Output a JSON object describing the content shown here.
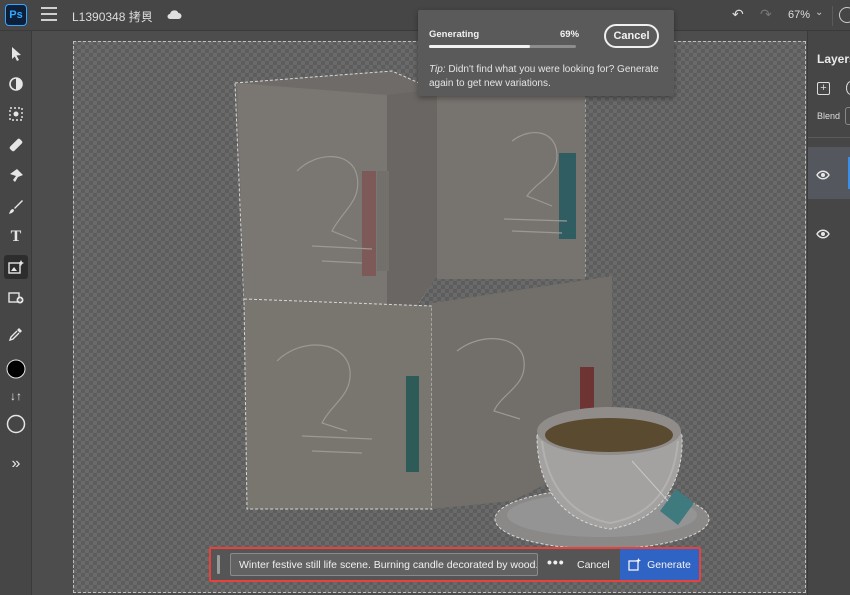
{
  "app": {
    "logo": "Ps",
    "document_title": "L1390348 拷貝",
    "zoom": "67%"
  },
  "toolbar": {
    "tools": [
      "move-tool-icon",
      "adjust-tool-icon",
      "select-subject-icon",
      "healing-brush-icon",
      "quick-action-icon",
      "brush-icon",
      "type-tool-icon",
      "generative-fill-icon",
      "add-image-icon",
      "eyedropper-icon",
      "foreground-color-swatch",
      "swap-colors-icon",
      "background-color-swatch",
      "more-tools-icon"
    ],
    "colors": {
      "foreground": "#000000",
      "background": "#ffffff"
    }
  },
  "generating": {
    "label": "Generating",
    "percent": "69%",
    "progress": 0.69,
    "cancel_label": "Cancel",
    "tip_prefix": "Tip:",
    "tip_text": "Didn't find what you were looking for? Generate again to get new variations."
  },
  "layers_panel": {
    "title": "Layers",
    "blend_label": "Blend"
  },
  "prompt_bar": {
    "prompt_text": "Winter festive still life scene. Burning candle decorated by wood...",
    "more_label": "•••",
    "cancel_label": "Cancel",
    "generate_label": "Generate"
  },
  "colors": {
    "accent": "#2f63c4",
    "highlight_border": "#e8403a"
  }
}
